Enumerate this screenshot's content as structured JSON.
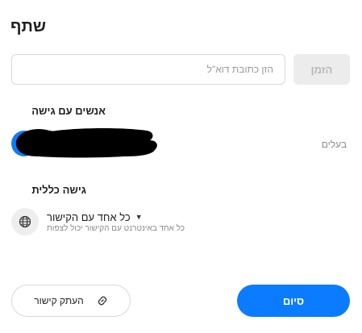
{
  "dialog": {
    "title": "שתף"
  },
  "invite": {
    "email_placeholder": "הזן כתובת דוא\"ל",
    "email_value": "",
    "button_label": "הזמן"
  },
  "people": {
    "heading": "אנשים עם גישה",
    "entries": [
      {
        "role": "בעלים",
        "name_redacted": true
      }
    ]
  },
  "general_access": {
    "heading": "גישה כללית",
    "selected": "כל אחד עם הקישור",
    "description": "כל אחד באינטרנט עם הקישור יכול לצפות"
  },
  "footer": {
    "copy_link_label": "העתק קישור",
    "done_label": "סיום"
  },
  "colors": {
    "accent": "#0b7cff",
    "disabled_bg": "#ececec",
    "disabled_text": "#b8b8b8",
    "muted_text": "#8a8a8a"
  },
  "icons": {
    "general_access": "globe-icon",
    "copy_link": "link-icon",
    "dropdown": "caret-down-icon"
  }
}
